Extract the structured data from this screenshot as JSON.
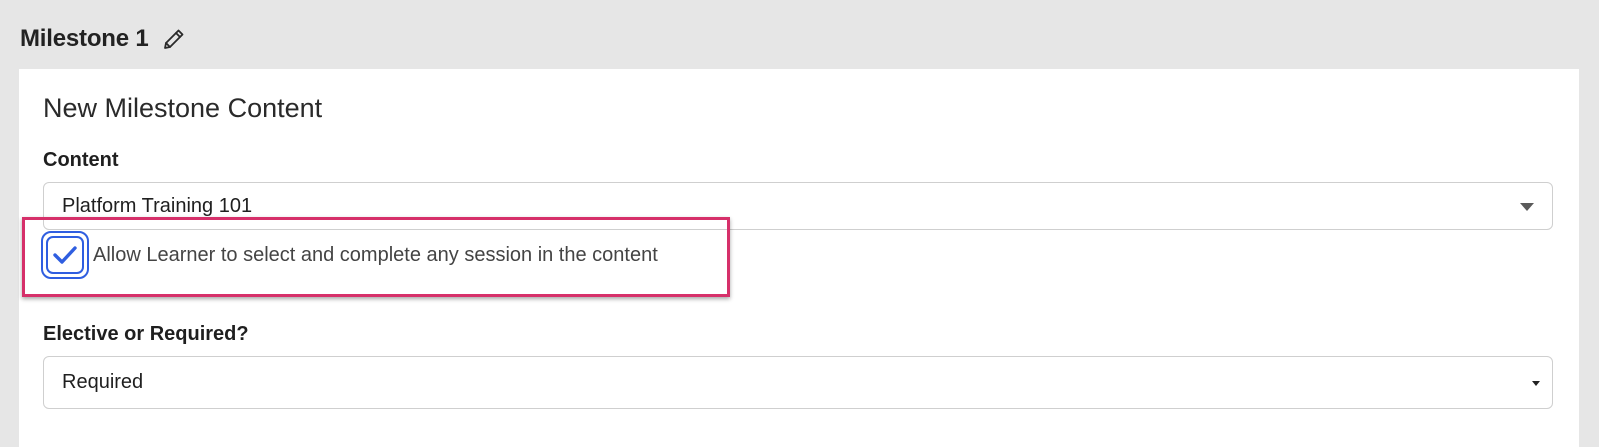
{
  "header": {
    "title": "Milestone 1",
    "edit_icon": "pencil-icon"
  },
  "panel": {
    "title": "New Milestone Content",
    "content_field": {
      "label": "Content",
      "selected_value": "Platform Training 101"
    },
    "allow_any_session": {
      "label": "Allow Learner to select and complete any session in the content",
      "checked": true
    },
    "elective_field": {
      "label": "Elective or Required?",
      "selected_value": "Required"
    }
  },
  "colors": {
    "background": "#e6e6e6",
    "panel": "#ffffff",
    "checkbox_accent": "#2f5ee0",
    "highlight": "#d6306a"
  }
}
